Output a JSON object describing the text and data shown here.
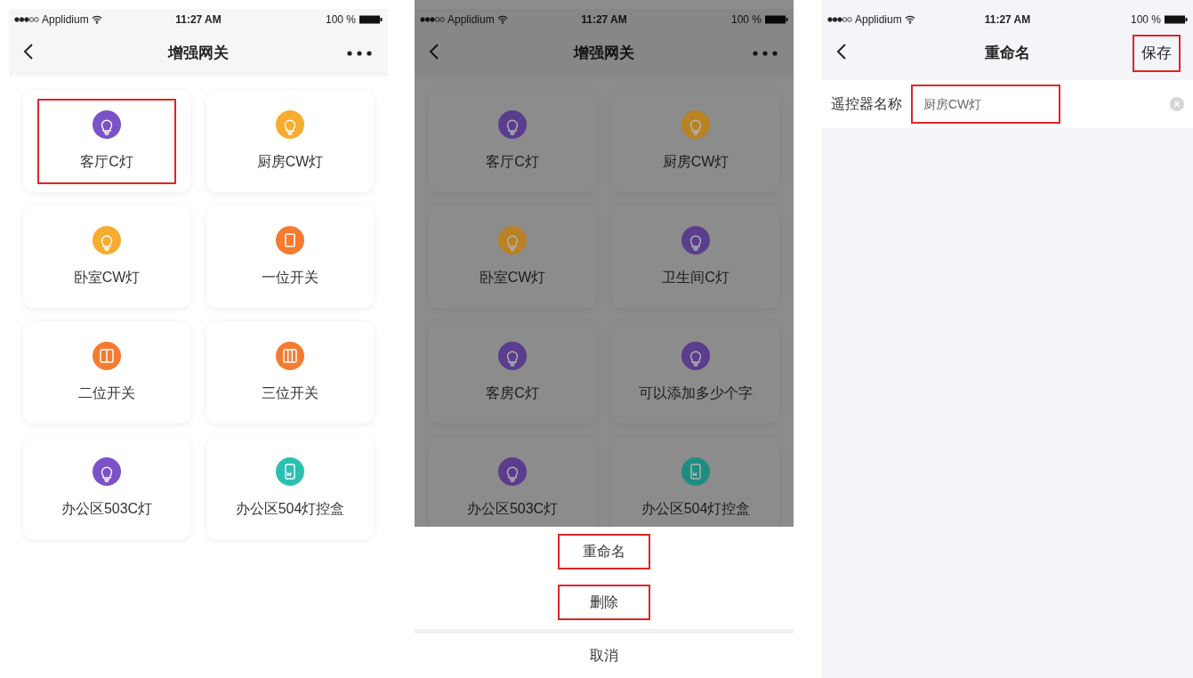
{
  "screens": [
    {
      "kind": "device_list",
      "status_bar": {
        "carrier": "Applidium",
        "time": "11:27 AM",
        "battery": "100 %"
      },
      "nav": {
        "title": "增强网关"
      },
      "dimmed": false,
      "devices": [
        {
          "name": "客厅C灯",
          "kind": "bulb",
          "color": "#7b52c7",
          "highlighted": true
        },
        {
          "name": "厨房CW灯",
          "kind": "bulb",
          "color": "#f6ac2e",
          "highlighted": false
        },
        {
          "name": "卧室CW灯",
          "kind": "bulb",
          "color": "#f6ac2e",
          "highlighted": false
        },
        {
          "name": "一位开关",
          "kind": "switch1",
          "color": "#f47b30",
          "highlighted": false
        },
        {
          "name": "二位开关",
          "kind": "switch2",
          "color": "#f47b30",
          "highlighted": false
        },
        {
          "name": "三位开关",
          "kind": "switch3",
          "color": "#f47b30",
          "highlighted": false
        },
        {
          "name": "办公区503C灯",
          "kind": "bulb",
          "color": "#7b52c7",
          "highlighted": false
        },
        {
          "name": "办公区504灯控盒",
          "kind": "box",
          "color": "#2cc0b2",
          "highlighted": false
        }
      ]
    },
    {
      "kind": "device_list",
      "status_bar": {
        "carrier": "Applidium",
        "time": "11:27 AM",
        "battery": "100 %"
      },
      "nav": {
        "title": "增强网关"
      },
      "dimmed": true,
      "devices": [
        {
          "name": "客厅C灯",
          "kind": "bulb",
          "color": "#5a3d8c",
          "highlighted": false
        },
        {
          "name": "厨房CW灯",
          "kind": "bulb",
          "color": "#b98222",
          "highlighted": false
        },
        {
          "name": "卧室CW灯",
          "kind": "bulb",
          "color": "#b98222",
          "highlighted": false
        },
        {
          "name": "卫生间C灯",
          "kind": "bulb",
          "color": "#5a3d8c",
          "highlighted": false
        },
        {
          "name": "客房C灯",
          "kind": "bulb",
          "color": "#5a3d8c",
          "highlighted": false
        },
        {
          "name": "可以添加多少个字",
          "kind": "bulb",
          "color": "#5a3d8c",
          "highlighted": false
        },
        {
          "name": "办公区503C灯",
          "kind": "bulb",
          "color": "#5a3d8c",
          "highlighted": false
        },
        {
          "name": "办公区504灯控盒",
          "kind": "box",
          "color": "#1f8c82",
          "highlighted": false
        }
      ],
      "action_sheet": {
        "actions": [
          {
            "label": "重命名",
            "highlighted": true
          },
          {
            "label": "删除",
            "highlighted": true
          }
        ],
        "cancel": "取消"
      }
    },
    {
      "kind": "rename",
      "status_bar": {
        "carrier": "Applidium",
        "time": "11:27 AM",
        "battery": "100 %"
      },
      "nav": {
        "title": "重命名",
        "action": "保存",
        "action_highlighted": true
      },
      "field": {
        "label": "遥控器名称",
        "value": "厨房CW灯",
        "highlighted": true
      }
    }
  ]
}
